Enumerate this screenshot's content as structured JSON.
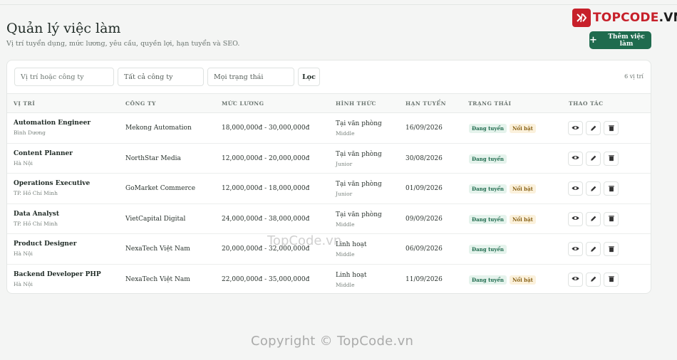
{
  "brand": {
    "logo_prefix": "T",
    "logo_accent": "OPCODE",
    "logo_suffix": ".VN",
    "accent_color": "#c7202a"
  },
  "header": {
    "title": "Quản lý việc làm",
    "subtitle": "Vị trí tuyển dụng, mức lương, yêu cầu, quyền lợi, hạn tuyển và SEO.",
    "add_button_label": "Thêm việc làm",
    "primary_color": "#1f6b4e"
  },
  "filters": {
    "search_placeholder": "Vị trí hoặc công ty",
    "company_value": "Tất cả công ty",
    "status_value": "Mọi trạng thái",
    "filter_button": "Lọc",
    "count_text": "6 vị trí"
  },
  "table": {
    "columns": [
      "Vị trí",
      "Công ty",
      "Mức lương",
      "Hình thức",
      "Hạn tuyển",
      "Trạng thái",
      "Thao tác"
    ],
    "rows": [
      {
        "title": "Automation Engineer",
        "location": "Bình Dương",
        "company": "Mekong Automation",
        "salary": "18,000,000đ - 30,000,000đ",
        "form": "Tại văn phòng",
        "level": "Middle",
        "deadline": "16/09/2026",
        "status": "Đang tuyển",
        "featured": "Nổi bật"
      },
      {
        "title": "Content Planner",
        "location": "Hà Nội",
        "company": "NorthStar Media",
        "salary": "12,000,000đ - 20,000,000đ",
        "form": "Tại văn phòng",
        "level": "Junior",
        "deadline": "30/08/2026",
        "status": "Đang tuyển",
        "featured": ""
      },
      {
        "title": "Operations Executive",
        "location": "TP. Hồ Chí Minh",
        "company": "GoMarket Commerce",
        "salary": "12,000,000đ - 18,000,000đ",
        "form": "Tại văn phòng",
        "level": "Junior",
        "deadline": "01/09/2026",
        "status": "Đang tuyển",
        "featured": "Nổi bật"
      },
      {
        "title": "Data Analyst",
        "location": "TP. Hồ Chí Minh",
        "company": "VietCapital Digital",
        "salary": "24,000,000đ - 38,000,000đ",
        "form": "Tại văn phòng",
        "level": "Middle",
        "deadline": "09/09/2026",
        "status": "Đang tuyển",
        "featured": "Nổi bật"
      },
      {
        "title": "Product Designer",
        "location": "Hà Nội",
        "company": "NexaTech Việt Nam",
        "salary": "20,000,000đ - 32,000,000đ",
        "form": "Linh hoạt",
        "level": "Middle",
        "deadline": "06/09/2026",
        "status": "Đang tuyển",
        "featured": ""
      },
      {
        "title": "Backend Developer PHP",
        "location": "Hà Nội",
        "company": "NexaTech Việt Nam",
        "salary": "22,000,000đ - 35,000,000đ",
        "form": "Linh hoạt",
        "level": "Middle",
        "deadline": "11/09/2026",
        "status": "Đang tuyển",
        "featured": "Nổi bật"
      }
    ],
    "action_icons": [
      "eye-icon",
      "pencil-icon",
      "trash-icon"
    ]
  },
  "watermarks": {
    "center": "TopCode.vn",
    "footer": "Copyright © TopCode.vn"
  }
}
